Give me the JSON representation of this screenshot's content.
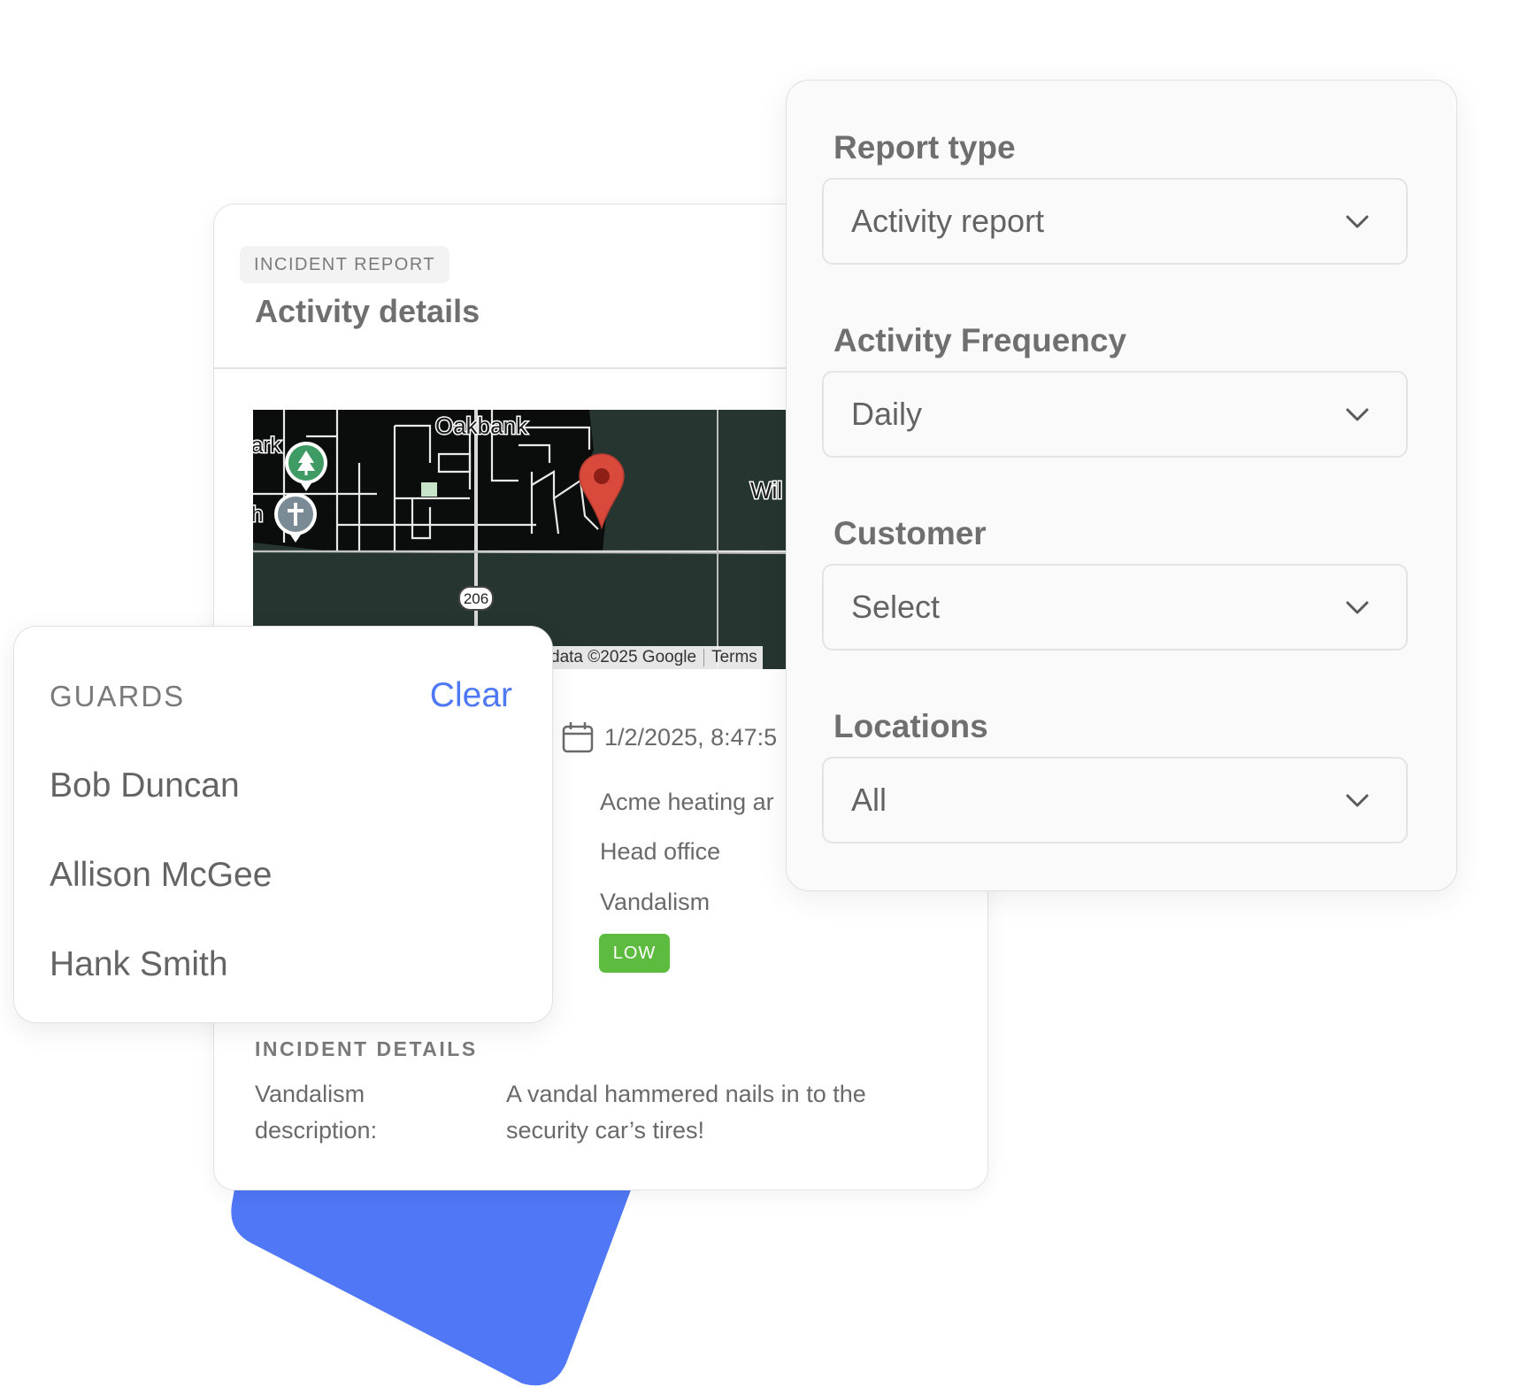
{
  "incident": {
    "tag": "INCIDENT REPORT",
    "title": "Activity details",
    "map": {
      "labels": {
        "oakbank": "Oakbank",
        "left_park": "ark",
        "left_church": "h",
        "right": "Wil",
        "road": "206"
      },
      "attribution": "data ©2025 Google",
      "terms": "Terms"
    },
    "datetime": "1/2/2025, 8:47:5",
    "customer": "Acme heating ar",
    "location": "Head office",
    "type": "Vandalism",
    "severity": "LOW",
    "section_title": "INCIDENT DETAILS",
    "desc_label": "Vandalism description:",
    "desc_value": "A vandal hammered nails in to the security car’s tires!",
    "colors": {
      "severity_low": "#5dbb3f",
      "pin": "#d94a3d",
      "map_bg": "#263530"
    }
  },
  "guards": {
    "title": "GUARDS",
    "clear_label": "Clear",
    "items": [
      "Bob Duncan",
      "Allison McGee",
      "Hank Smith"
    ],
    "accent": "#4f78f5"
  },
  "filters": {
    "report_type": {
      "label": "Report type",
      "value": "Activity report"
    },
    "frequency": {
      "label": "Activity Frequency",
      "value": "Daily"
    },
    "customer": {
      "label": "Customer",
      "value": "Select"
    },
    "locations": {
      "label": "Locations",
      "value": "All"
    }
  },
  "decor": {
    "blue": "#5077f6"
  }
}
